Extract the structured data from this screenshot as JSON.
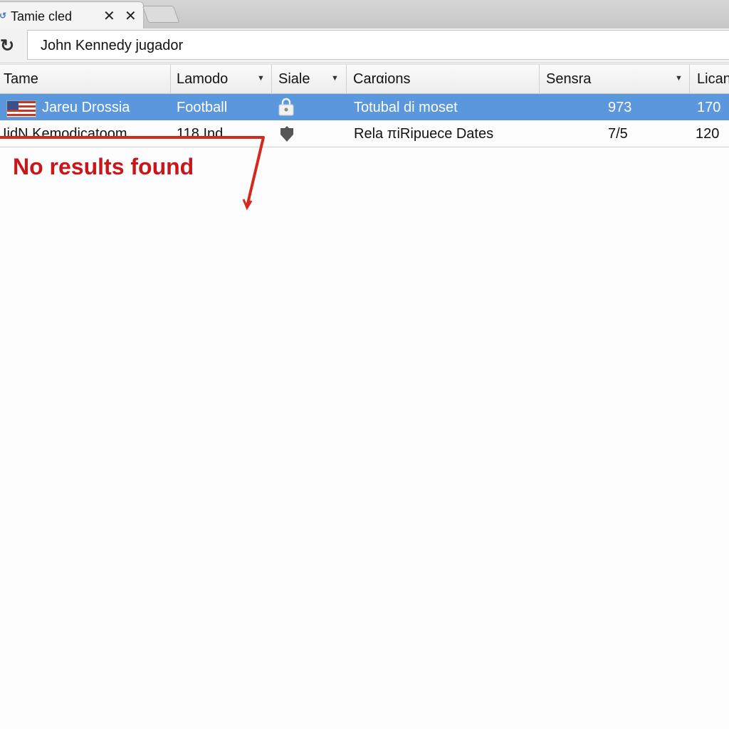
{
  "browser": {
    "tab": {
      "title": "Tamie cled",
      "favicon": "browser-tab-icon",
      "close_icons": [
        "close-icon",
        "close-icon"
      ]
    },
    "new_tab": "new-tab-button",
    "reload_icon": "reload-icon",
    "address": {
      "value": "John Kennedy jugador"
    }
  },
  "table": {
    "columns": [
      {
        "label": "Tame",
        "sortable": false
      },
      {
        "label": "Lamodo",
        "sortable": true
      },
      {
        "label": "Siale",
        "sortable": true
      },
      {
        "label": "Carαions",
        "sortable": false
      },
      {
        "label": "Sensra",
        "sortable": true
      },
      {
        "label": "Lican",
        "sortable": false
      }
    ],
    "rows": [
      {
        "selected": true,
        "icon": "us-flag-icon",
        "name": "Jareu Drossia",
        "lamodo": "Football",
        "siale_icon": "lock-icon",
        "carαions": "Totubal di moset",
        "sensra": "973",
        "lican": "170"
      },
      {
        "selected": false,
        "name": "IidN  Kemodicatoom",
        "lamodo": "118 Ind",
        "siale_icon": "shield-icon",
        "carαions": "Rela πiRipuece Dates",
        "sensra": "7/5",
        "lican": "120"
      }
    ]
  },
  "annotation": {
    "text": "No results found",
    "color": "#c8161b"
  },
  "colors": {
    "selection": "#5b97dc",
    "annotation_red": "#d42a1e"
  }
}
